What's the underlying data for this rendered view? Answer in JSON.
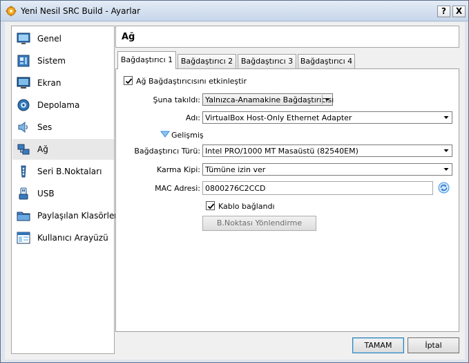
{
  "window": {
    "title": "Yeni Nesil SRC Build - Ayarlar",
    "help_label": "?",
    "close_label": "X"
  },
  "sidebar": {
    "items": [
      {
        "label": "Genel",
        "icon": "monitor-icon"
      },
      {
        "label": "Sistem",
        "icon": "motherboard-icon"
      },
      {
        "label": "Ekran",
        "icon": "display-icon"
      },
      {
        "label": "Depolama",
        "icon": "storage-icon"
      },
      {
        "label": "Ses",
        "icon": "speaker-icon"
      },
      {
        "label": "Ağ",
        "icon": "network-icon",
        "selected": true
      },
      {
        "label": "Seri B.Noktaları",
        "icon": "serial-port-icon"
      },
      {
        "label": "USB",
        "icon": "usb-icon"
      },
      {
        "label": "Paylaşılan Klasörler",
        "icon": "folder-icon"
      },
      {
        "label": "Kullanıcı Arayüzü",
        "icon": "ui-window-icon"
      }
    ]
  },
  "page": {
    "title": "Ağ"
  },
  "tabs": [
    "Bağdaştırıcı 1",
    "Bağdaştırıcı 2",
    "Bağdaştırıcı 3",
    "Bağdaştırıcı 4"
  ],
  "form": {
    "enable_label": "Ağ Bağdaştırıcısını etkinleştir",
    "attached_label": "Şuna takıldı:",
    "attached_value": "Yalnızca-Anamakine Bağdaştırıcısı",
    "name_label": "Adı:",
    "name_value": "VirtualBox Host-Only Ethernet Adapter",
    "advanced_label": "Gelişmiş",
    "adapter_type_label": "Bağdaştırıcı Türü:",
    "adapter_type_value": "Intel PRO/1000 MT Masaüstü (82540EM)",
    "promisc_label": "Karma Kipi:",
    "promisc_value": "Tümüne izin ver",
    "mac_label": "MAC Adresi:",
    "mac_value": "0800276C2CCD",
    "cable_label": "Kablo bağlandı",
    "port_forward_label": "B.Noktası Yönlendirme"
  },
  "buttons": {
    "ok": "TAMAM",
    "cancel": "İptal"
  },
  "colors": {
    "accent": "#3c7fb1",
    "advanced_arrow": "#3b8de0"
  }
}
